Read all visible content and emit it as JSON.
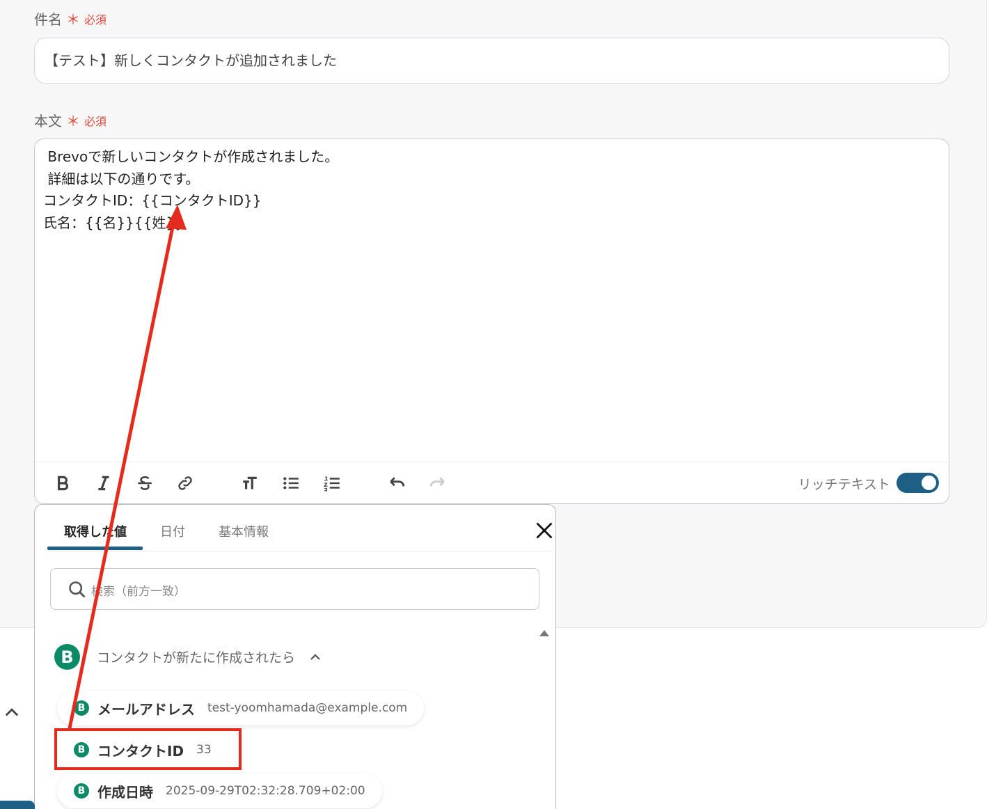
{
  "subject": {
    "label": "件名",
    "required_mark": "＊",
    "required_text": "必須",
    "value": "【テスト】新しくコンタクトが追加されました"
  },
  "body": {
    "label": "本文",
    "required_mark": "＊",
    "required_text": "必須",
    "lines": [
      " Brevoで新しいコンタクトが作成されました。",
      " 詳細は以下の通りです。",
      "コンタクトID：{{コンタクトID}}",
      "氏名：{{名}}{{姓}}"
    ]
  },
  "toolbar": {
    "buttons": [
      "bold-icon",
      "italic-icon",
      "strikethrough-icon",
      "link-icon",
      "text-size-icon",
      "bullet-list-icon",
      "numbered-list-icon",
      "undo-icon",
      "redo-icon"
    ],
    "rich_text_label": "リッチテキスト",
    "rich_text_enabled": true
  },
  "popup": {
    "tabs": [
      {
        "label": "取得した値",
        "active": true
      },
      {
        "label": "日付",
        "active": false
      },
      {
        "label": "基本情報",
        "active": false
      }
    ],
    "search_placeholder": "検索（前方一致）",
    "group": {
      "logo_letter": "B",
      "title": "コンタクトが新たに作成されたら"
    },
    "items": [
      {
        "label": "メールアドレス",
        "value": "test-yoomhamada@example.com"
      },
      {
        "label": "コンタクトID",
        "value": "33"
      },
      {
        "label": "作成日時",
        "value": "2025-09-29T02:32:28.709+02:00"
      }
    ]
  },
  "colors": {
    "accent": "#1e5f86",
    "required": "#e2483d",
    "brevo_green": "#0b8a68",
    "annotation_red": "#e42b1e"
  }
}
